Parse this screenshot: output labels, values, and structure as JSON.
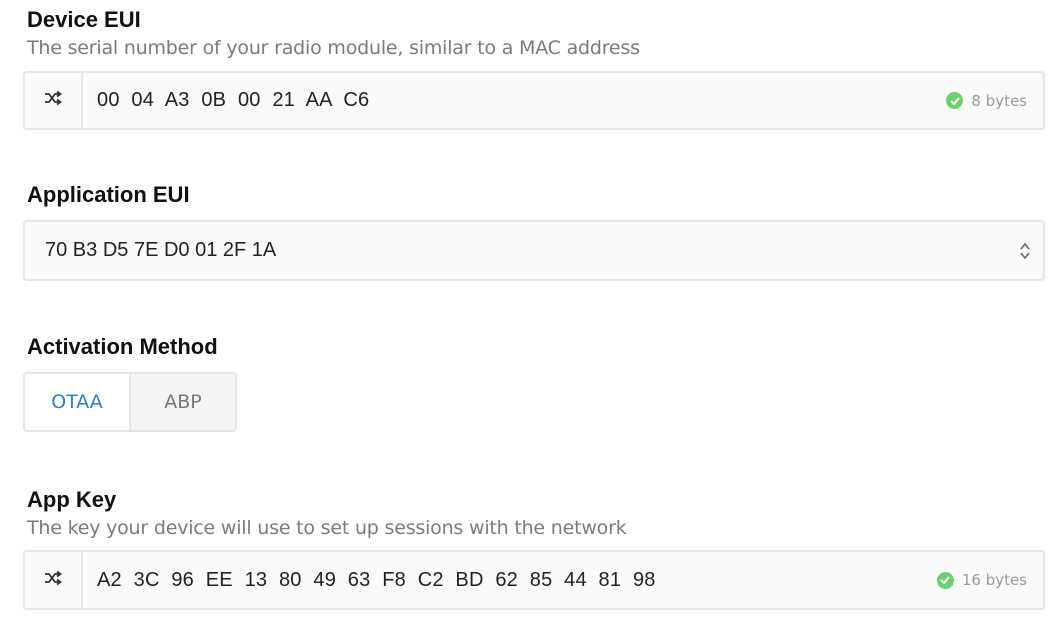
{
  "device_eui": {
    "label": "Device EUI",
    "description": "The serial number of your radio module, similar to a MAC address",
    "value": "00 04 A3 0B 00 21 AA C6",
    "bytes": "8 bytes"
  },
  "application_eui": {
    "label": "Application EUI",
    "value": "70 B3 D5 7E D0 01 2F 1A"
  },
  "activation_method": {
    "label": "Activation Method",
    "options": [
      "OTAA",
      "ABP"
    ],
    "selected": "OTAA"
  },
  "app_key": {
    "label": "App Key",
    "description": "The key your device will use to set up sessions with the network",
    "value": "A2 3C 96 EE 13 80 49 63 F8 C2 BD 62 85 44 81 98",
    "bytes": "16 bytes"
  },
  "colors": {
    "accent": "#2f7fc6",
    "success": "#6dcf6d",
    "border": "#e6e6e6"
  },
  "icons": {
    "shuffle": "shuffle-icon",
    "check": "check-circle-icon",
    "chevron": "chevron-up-down-icon"
  }
}
